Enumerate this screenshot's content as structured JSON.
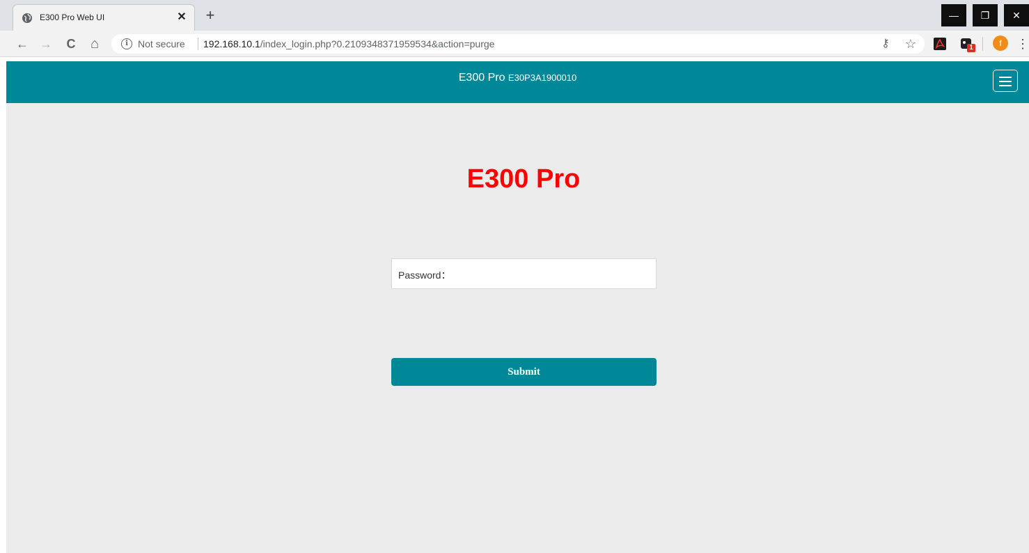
{
  "browser": {
    "tab_title": "E300 Pro Web UI",
    "tab_close": "✕",
    "new_tab": "+",
    "back": "←",
    "forward": "→",
    "reload": "C",
    "home": "⌂",
    "info_glyph": "i",
    "security_label": "Not secure",
    "url_host": "192.168.10.1",
    "url_path": "/index_login.php?0.2109348371959534&action=purge",
    "key_icon": "⚷",
    "star_icon": "☆",
    "ext_badge": "1",
    "profile_initial": "f",
    "menu_dots": "⋮",
    "window_controls": {
      "minimize": "—",
      "restore": "❐",
      "close": "✕"
    }
  },
  "header": {
    "product": "E300 Pro",
    "serial": "E30P3A1900010"
  },
  "main": {
    "brand_title": "E300 Pro",
    "password_label": "Password：",
    "submit_label": "Submit"
  },
  "colors": {
    "header_bg": "#008899",
    "brand_text": "#ff0000",
    "page_bg": "#ebebeb"
  }
}
